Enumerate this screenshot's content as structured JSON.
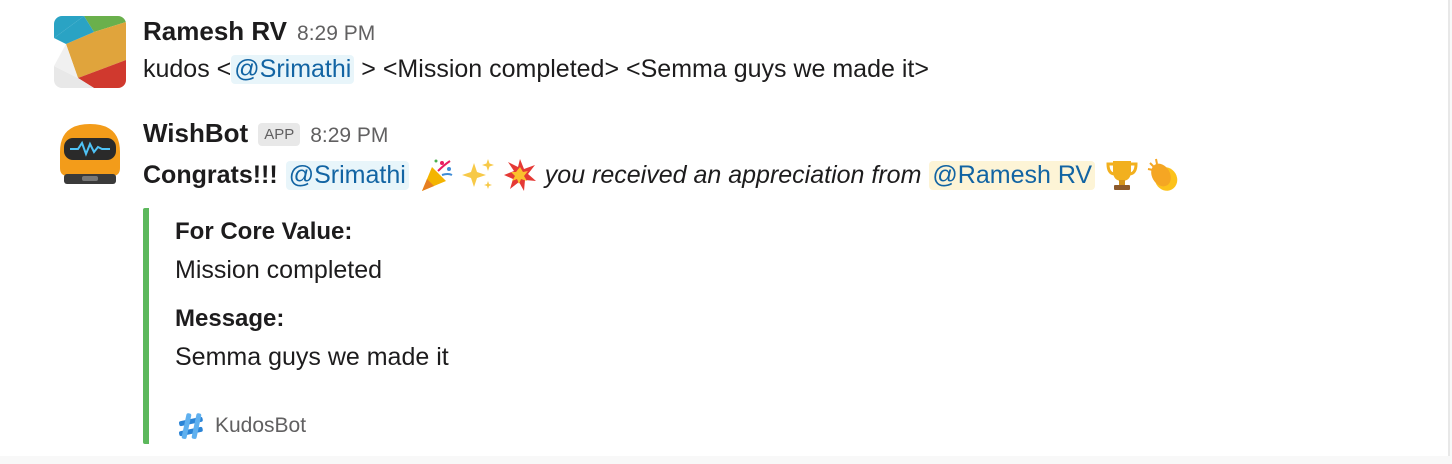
{
  "messages": [
    {
      "author": "Ramesh RV",
      "time": "8:29 PM",
      "text_prefix": "kudos <",
      "mention": "@Srimathi",
      "text_suffix": " > <Mission completed> <Semma guys we made it>"
    },
    {
      "author": "WishBot",
      "badge": "APP",
      "time": "8:29 PM",
      "greeting": "Congrats!!!",
      "mention": "@Srimathi",
      "emojis_before": [
        "party-popper",
        "sparkles",
        "collision"
      ],
      "text": "you received an appreciation from",
      "mention_from": "@Ramesh RV",
      "emojis_after": [
        "trophy",
        "clapping-hands"
      ],
      "attachment": {
        "accent_color": "#5cb85c",
        "fields": [
          {
            "title": "For Core Value:",
            "value": "Mission completed"
          },
          {
            "title": "Message:",
            "value": "Semma guys we made it"
          }
        ],
        "footer": "KudosBot"
      }
    }
  ],
  "colors": {
    "mention_text": "#1264a3",
    "mention_bg": "#e8f5fa",
    "mention_self_bg": "#fdf4d6",
    "muted": "#616061"
  }
}
